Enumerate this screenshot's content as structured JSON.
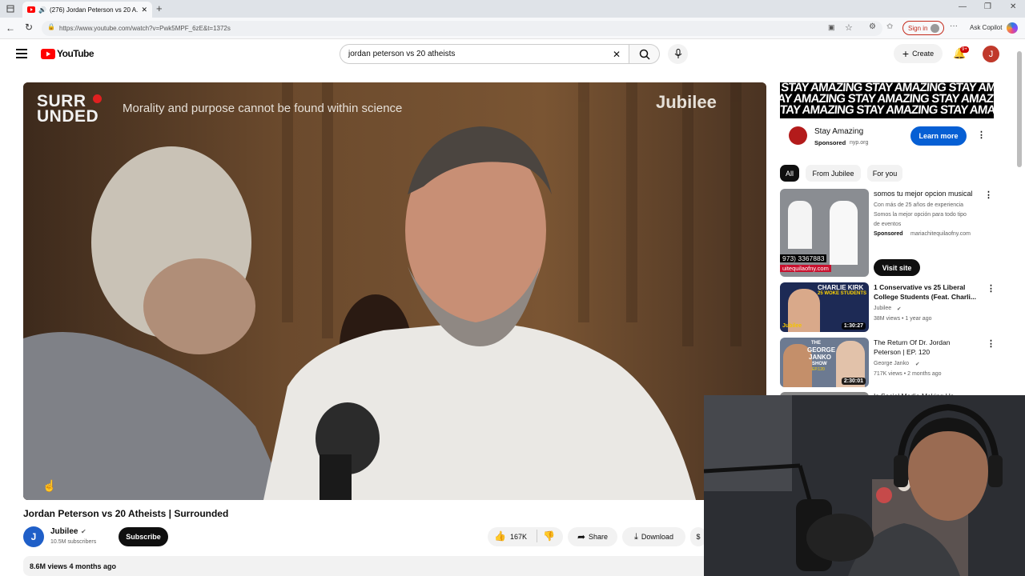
{
  "browser": {
    "tab_title": "(276) Jordan Peterson vs 20 A...",
    "url": "https://www.youtube.com/watch?v=Pwk5MPF_6zE&t=1372s",
    "sign_in_label": "Sign in",
    "ask_copilot_label": "Ask Copilot"
  },
  "header": {
    "logo_text": "YouTube",
    "search_value": "jordan peterson vs 20 atheists",
    "create_label": "Create",
    "notif_badge": "9+",
    "avatar_letter": "J"
  },
  "video": {
    "brand_left": "SURR UNDED",
    "overlay_caption": "Morality and purpose cannot be found within science",
    "brand_right": "Jubilee",
    "title": "Jordan Peterson vs 20 Atheists | Surrounded",
    "channel_name": "Jubilee",
    "channel_subs": "10.5M subscribers",
    "subscribe_label": "Subscribe",
    "likes": "167K",
    "share_label": "Share",
    "download_label": "Download",
    "views_date": "8.6M views  4 months ago"
  },
  "ad": {
    "banner_text": "STAY AMAZING STAY AMAZING STAY AMAZING STAY AMAZING",
    "title": "Stay Amazing",
    "sponsored": "Sponsored",
    "source": "nyp.org",
    "learn_more_label": "Learn more"
  },
  "filters": [
    "All",
    "From Jubilee",
    "For you"
  ],
  "sponsored_card": {
    "title": "somos tu mejor opcion musical",
    "desc1": "Con más de 25 años de experiencia",
    "desc2": "Somos la mejor opción para todo tipo",
    "desc3": "de eventos",
    "sponsored": "Sponsored",
    "source": "mariachitequilaofny.com",
    "phone": "973) 3367883",
    "domain_thumb": "uitequilaofny.com",
    "visit_label": "Visit site"
  },
  "related": [
    {
      "title1": "1 Conservative vs 25 Liberal",
      "title2": "College Students (Feat. Charli...",
      "channel": "Jubilee",
      "meta": "38M views • 1 year ago",
      "duration": "1:30:27",
      "thumb_text1": "CHARLIE KIRK",
      "thumb_text2": "25 WOKE STUDENTS",
      "thumb_text3": "Jubilee"
    },
    {
      "title1": "The Return Of Dr. Jordan",
      "title2": "Peterson | EP. 120",
      "channel": "George Janko",
      "meta": "717K views • 2 months ago",
      "duration": "2:30:01",
      "thumb_text1": "THE",
      "thumb_text2": "GEORGE",
      "thumb_text3": "JANKO",
      "thumb_text4": "SHOW",
      "thumb_text5": "EP.120"
    },
    {
      "title1": "Is Social Media Making Us"
    }
  ],
  "colors": {
    "youtube_red": "#ff0000",
    "subscribe_bg": "#0f0f0f",
    "learn_more_bg": "#065fd4",
    "avatar_bg": "#c0392b"
  }
}
